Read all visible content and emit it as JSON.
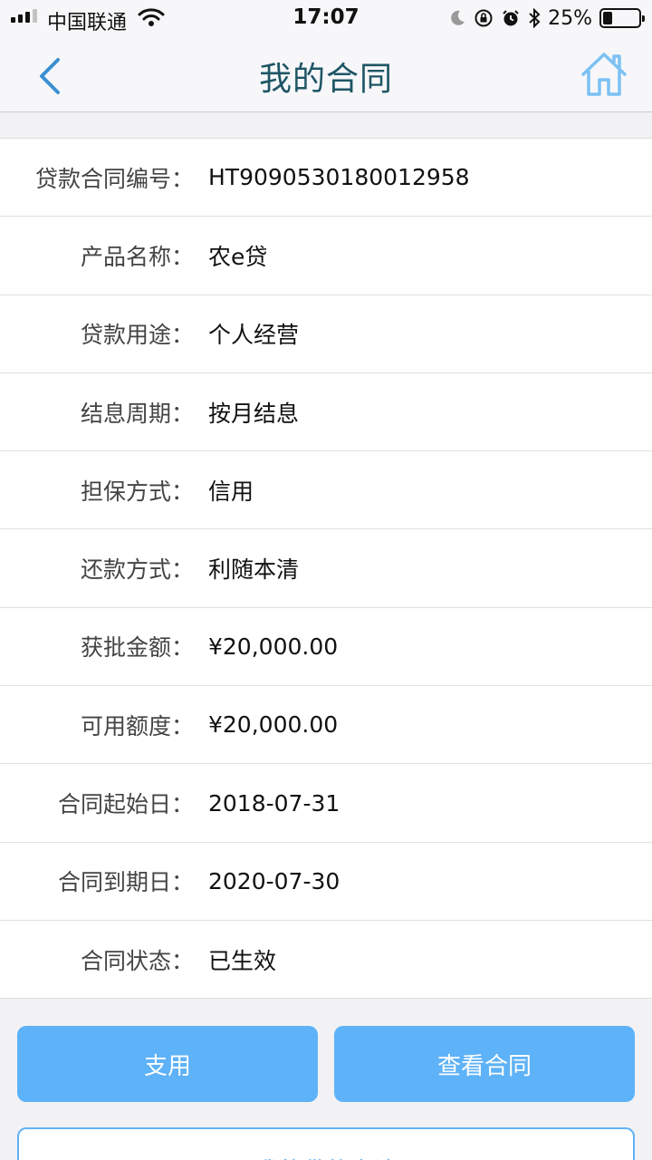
{
  "status_bar": {
    "carrier": "中国联通",
    "time": "17:07",
    "battery_percent_text": "25%",
    "battery_level": 0.25
  },
  "header": {
    "title": "我的合同",
    "back_icon": "chevron-left-icon",
    "home_icon": "home-icon"
  },
  "contract": [
    {
      "label": "贷款合同编号：",
      "value": "HT9090530180012958"
    },
    {
      "label": "产品名称：",
      "value": "农e贷"
    },
    {
      "label": "贷款用途：",
      "value": "个人经营"
    },
    {
      "label": "结息周期：",
      "value": "按月结息"
    },
    {
      "label": "担保方式：",
      "value": "信用"
    },
    {
      "label": "还款方式：",
      "value": "利随本清"
    },
    {
      "label": "获批金额：",
      "value": "¥20,000.00"
    },
    {
      "label": "可用额度：",
      "value": "¥20,000.00"
    },
    {
      "label": "合同起始日：",
      "value": "2018-07-31"
    },
    {
      "label": "合同到期日：",
      "value": "2020-07-30"
    },
    {
      "label": "合同状态：",
      "value": "已生效"
    }
  ],
  "actions": {
    "use_label": "支用",
    "view_contract_label": "查看合同",
    "my_loans_label": "我的贷款申请"
  },
  "colors": {
    "accent": "#5eb2f7",
    "title": "#1e5565"
  }
}
